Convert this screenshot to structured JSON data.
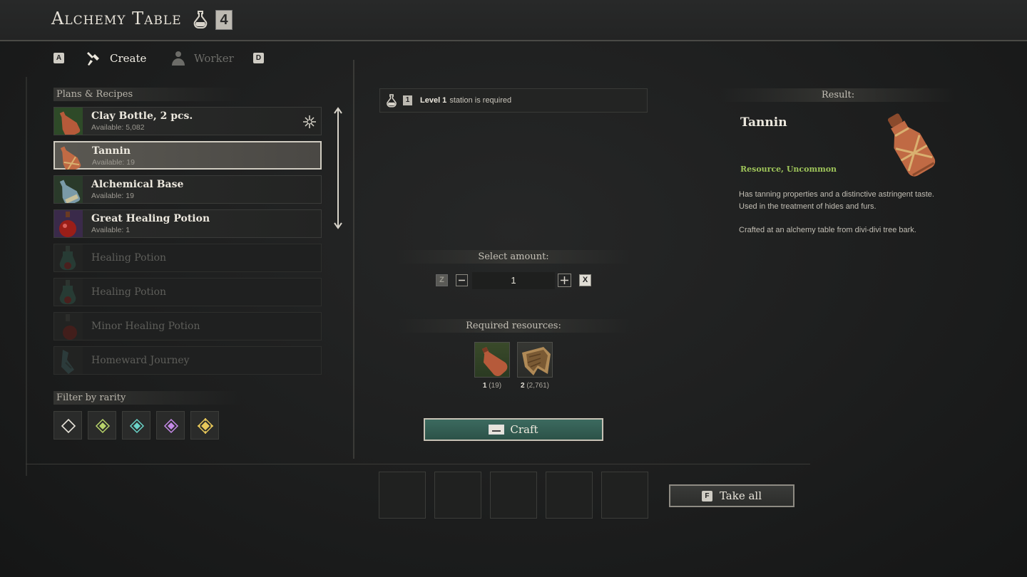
{
  "header": {
    "title": "Alchemy Table",
    "station_level": "4"
  },
  "tabs": {
    "prev_key": "A",
    "create_label": "Create",
    "worker_label": "Worker",
    "next_key": "D"
  },
  "recipes_section": {
    "heading": "Plans & Recipes",
    "items": [
      {
        "name": "Clay Bottle, 2 pcs.",
        "available": "Available: 5,082",
        "state": "normal",
        "icon": "clay-bottle-icon"
      },
      {
        "name": "Tannin",
        "available": "Available: 19",
        "state": "selected",
        "icon": "tannin-icon"
      },
      {
        "name": "Alchemical Base",
        "available": "Available: 19",
        "state": "normal",
        "icon": "alchemical-base-icon"
      },
      {
        "name": "Great Healing Potion",
        "available": "Available: 1",
        "state": "normal",
        "icon": "great-healing-potion-icon"
      },
      {
        "name": "Healing Potion",
        "available": "",
        "state": "disabled",
        "icon": "healing-potion-icon"
      },
      {
        "name": "Healing Potion",
        "available": "",
        "state": "disabled",
        "icon": "healing-potion-icon"
      },
      {
        "name": "Minor Healing Potion",
        "available": "",
        "state": "disabled",
        "icon": "minor-healing-potion-icon"
      },
      {
        "name": "Homeward Journey",
        "available": "",
        "state": "disabled",
        "icon": "homeward-journey-icon"
      }
    ]
  },
  "filter": {
    "heading": "Filter by rarity",
    "rarities": [
      {
        "name": "common",
        "color": "#e8e4da"
      },
      {
        "name": "uncommon",
        "color": "#b8d46a"
      },
      {
        "name": "rare",
        "color": "#6ad4c8"
      },
      {
        "name": "epic",
        "color": "#c58ae8"
      },
      {
        "name": "legendary",
        "color": "#e8c85a"
      }
    ]
  },
  "requirement": {
    "level_badge": "1",
    "level_text": "Level 1",
    "suffix": "station is required"
  },
  "amount": {
    "heading": "Select amount:",
    "value": "1",
    "min_key": "Z",
    "max_key": "X"
  },
  "resources": {
    "heading": "Required resources:",
    "items": [
      {
        "required": "1",
        "owned": "(19)",
        "icon": "clay-bottle-icon"
      },
      {
        "required": "2",
        "owned": "(2,761)",
        "icon": "bark-icon"
      }
    ]
  },
  "craft": {
    "label": "Craft"
  },
  "take_all": {
    "key": "F",
    "label": "Take all"
  },
  "result": {
    "heading": "Result:",
    "name": "Tannin",
    "rarity": "Resource, Uncommon",
    "description_1": "Has tanning properties and a distinctive astringent taste. Used in the treatment of hides and furs.",
    "description_2": "Crafted at an alchemy table from divi-divi tree bark."
  },
  "colors": {
    "accent_green": "#2f5a4f",
    "uncommon": "#9ec45a"
  }
}
